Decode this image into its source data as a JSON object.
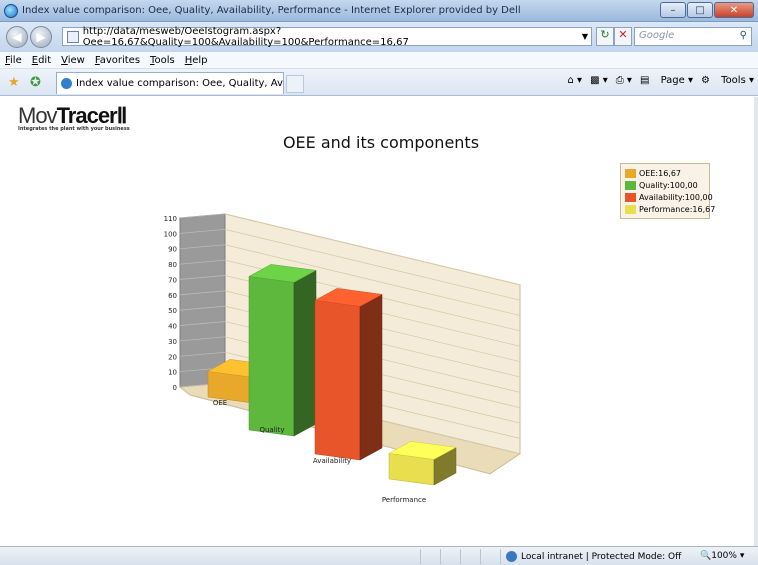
{
  "window": {
    "title": "Index value comparison: Oee, Quality, Availability, Performance - Internet Explorer provided by Dell"
  },
  "address": {
    "url": "http://data/mesweb/OeeIstogram.aspx?Oee=16,67&Quality=100&Availability=100&Performance=16,67",
    "search_placeholder": "Google"
  },
  "menu": [
    "File",
    "Edit",
    "View",
    "Favorites",
    "Tools",
    "Help"
  ],
  "tab": {
    "label": "Index value comparison: Oee, Quality, Availability..."
  },
  "toolbar": {
    "page_label": "Page",
    "tools_label": "Tools"
  },
  "logo": {
    "brand_prefix": "Mov",
    "brand_bold": "Tracer",
    "tagline": "Integrates the plant with your business"
  },
  "status": {
    "zone": "Local intranet | Protected Mode: Off",
    "zoom": "100%"
  },
  "chart_data": {
    "type": "bar",
    "title": "OEE and its components",
    "categories": [
      "OEE",
      "Quality",
      "Availability",
      "Performance"
    ],
    "values": [
      16.67,
      100,
      100,
      16.67
    ],
    "colors": [
      "#e8a82a",
      "#5fb83e",
      "#e8552a",
      "#e8de4e"
    ],
    "legend": [
      "OEE:16,67",
      "Quality:100,00",
      "Availability:100,00",
      "Performance:16,67"
    ],
    "yticks": [
      "0",
      "10",
      "20",
      "30",
      "40",
      "50",
      "60",
      "70",
      "80",
      "90",
      "100",
      "110"
    ],
    "ylim": [
      0,
      110
    ],
    "legend_position": "top-right",
    "grid": true
  }
}
